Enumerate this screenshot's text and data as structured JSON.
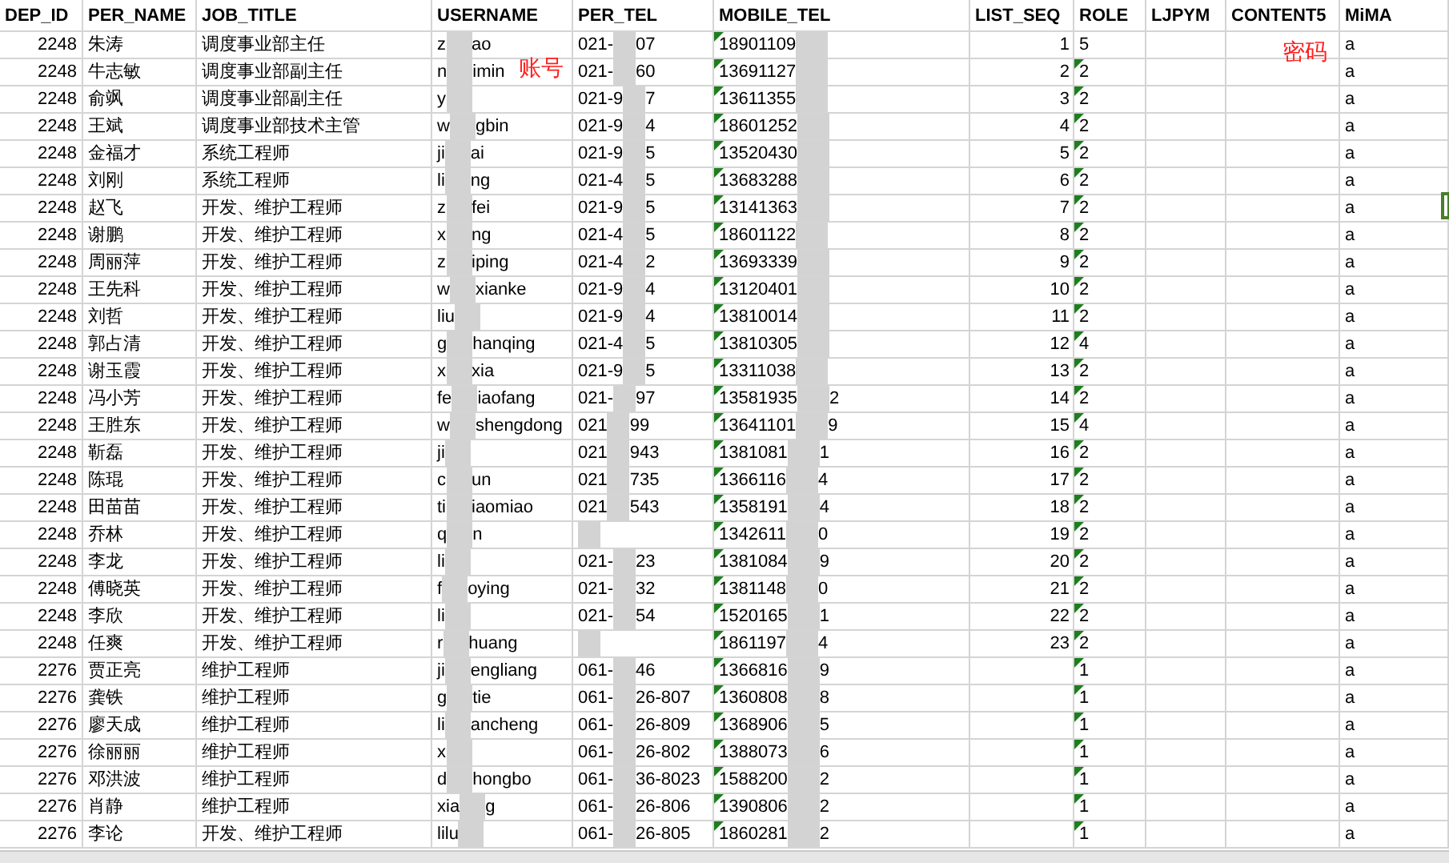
{
  "columns": [
    "DEP_ID",
    "PER_NAME",
    "JOB_TITLE",
    "USERNAME",
    "PER_TEL",
    "MOBILE_TEL",
    "LIST_SEQ",
    "ROLE",
    "LJPYM",
    "CONTENT5",
    "MiMA"
  ],
  "rows": [
    {
      "dep_id": "2248",
      "per_name": "朱涛",
      "job_title": "调度事业部主任",
      "username": [
        "z",
        "ao"
      ],
      "per_tel": [
        "021-",
        "07"
      ],
      "mobile_tel": [
        "18901109"
      ],
      "mobile_flag": true,
      "list_seq": "1",
      "role": "5",
      "role_flag": false,
      "mima": "a"
    },
    {
      "dep_id": "2248",
      "per_name": "牛志敏",
      "job_title": "调度事业部副主任",
      "username": [
        "n",
        "imin"
      ],
      "per_tel": [
        "021-",
        "60"
      ],
      "mobile_tel": [
        "13691127"
      ],
      "mobile_flag": true,
      "list_seq": "2",
      "role": "2",
      "role_flag": true,
      "mima": "a"
    },
    {
      "dep_id": "2248",
      "per_name": "俞飒",
      "job_title": "调度事业部副主任",
      "username": [
        "y"
      ],
      "per_tel": [
        "021-9",
        "7"
      ],
      "mobile_tel": [
        "13611355"
      ],
      "mobile_flag": true,
      "list_seq": "3",
      "role": "2",
      "role_flag": true,
      "mima": "a"
    },
    {
      "dep_id": "2248",
      "per_name": "王斌",
      "job_title": "调度事业部技术主管",
      "username": [
        "w",
        "gbin"
      ],
      "per_tel": [
        "021-9",
        "4"
      ],
      "mobile_tel": [
        "18601252"
      ],
      "mobile_flag": true,
      "list_seq": "4",
      "role": "2",
      "role_flag": true,
      "mima": "a"
    },
    {
      "dep_id": "2248",
      "per_name": "金福才",
      "job_title": "系统工程师",
      "username": [
        "ji",
        "ai"
      ],
      "per_tel": [
        "021-9",
        "5"
      ],
      "mobile_tel": [
        "13520430"
      ],
      "mobile_flag": true,
      "list_seq": "5",
      "role": "2",
      "role_flag": true,
      "mima": "a"
    },
    {
      "dep_id": "2248",
      "per_name": "刘刚",
      "job_title": "系统工程师",
      "username": [
        "li",
        "ng"
      ],
      "per_tel": [
        "021-4",
        "5"
      ],
      "mobile_tel": [
        "13683288"
      ],
      "mobile_flag": true,
      "list_seq": "6",
      "role": "2",
      "role_flag": true,
      "mima": "a"
    },
    {
      "dep_id": "2248",
      "per_name": "赵飞",
      "job_title": "开发、维护工程师",
      "username": [
        "z",
        "fei"
      ],
      "per_tel": [
        "021-9",
        "5"
      ],
      "mobile_tel": [
        "13141363"
      ],
      "mobile_flag": true,
      "list_seq": "7",
      "role": "2",
      "role_flag": true,
      "mima": "a"
    },
    {
      "dep_id": "2248",
      "per_name": "谢鹏",
      "job_title": "开发、维护工程师",
      "username": [
        "x",
        "ng"
      ],
      "per_tel": [
        "021-4",
        "5"
      ],
      "mobile_tel": [
        "18601122"
      ],
      "mobile_flag": true,
      "list_seq": "8",
      "role": "2",
      "role_flag": true,
      "mima": "a"
    },
    {
      "dep_id": "2248",
      "per_name": "周丽萍",
      "job_title": "开发、维护工程师",
      "username": [
        "z",
        "iping"
      ],
      "per_tel": [
        "021-4",
        "2"
      ],
      "mobile_tel": [
        "13693339"
      ],
      "mobile_flag": true,
      "list_seq": "9",
      "role": "2",
      "role_flag": true,
      "mima": "a"
    },
    {
      "dep_id": "2248",
      "per_name": "王先科",
      "job_title": "开发、维护工程师",
      "username": [
        "w",
        "xianke"
      ],
      "per_tel": [
        "021-9",
        "4"
      ],
      "mobile_tel": [
        "13120401"
      ],
      "mobile_flag": true,
      "list_seq": "10",
      "role": "2",
      "role_flag": true,
      "mima": "a"
    },
    {
      "dep_id": "2248",
      "per_name": "刘哲",
      "job_title": "开发、维护工程师",
      "username": [
        "liu"
      ],
      "per_tel": [
        "021-9",
        "4"
      ],
      "mobile_tel": [
        "13810014"
      ],
      "mobile_flag": true,
      "list_seq": "11",
      "role": "2",
      "role_flag": true,
      "mima": "a"
    },
    {
      "dep_id": "2248",
      "per_name": "郭占清",
      "job_title": "开发、维护工程师",
      "username": [
        "g",
        "hanqing"
      ],
      "per_tel": [
        "021-4",
        "5"
      ],
      "mobile_tel": [
        "13810305"
      ],
      "mobile_flag": true,
      "list_seq": "12",
      "role": "4",
      "role_flag": true,
      "mima": "a"
    },
    {
      "dep_id": "2248",
      "per_name": "谢玉霞",
      "job_title": "开发、维护工程师",
      "username": [
        "x",
        "xia"
      ],
      "per_tel": [
        "021-9",
        "5"
      ],
      "mobile_tel": [
        "13311038"
      ],
      "mobile_flag": true,
      "list_seq": "13",
      "role": "2",
      "role_flag": true,
      "mima": "a"
    },
    {
      "dep_id": "2248",
      "per_name": "冯小芳",
      "job_title": "开发、维护工程师",
      "username": [
        "fe",
        "iaofang"
      ],
      "per_tel": [
        "021-",
        "97"
      ],
      "mobile_tel": [
        "13581935",
        "2"
      ],
      "mobile_flag": true,
      "list_seq": "14",
      "role": "2",
      "role_flag": true,
      "mima": "a"
    },
    {
      "dep_id": "2248",
      "per_name": "王胜东",
      "job_title": "开发、维护工程师",
      "username": [
        "w",
        "shengdong"
      ],
      "per_tel": [
        "021",
        "99"
      ],
      "mobile_tel": [
        "13641101",
        "9"
      ],
      "mobile_flag": true,
      "list_seq": "15",
      "role": "4",
      "role_flag": true,
      "mima": "a"
    },
    {
      "dep_id": "2248",
      "per_name": "靳磊",
      "job_title": "开发、维护工程师",
      "username": [
        "ji"
      ],
      "per_tel": [
        "021",
        "943"
      ],
      "mobile_tel": [
        "1381081",
        "1"
      ],
      "mobile_flag": true,
      "list_seq": "16",
      "role": "2",
      "role_flag": true,
      "mima": "a"
    },
    {
      "dep_id": "2248",
      "per_name": "陈琨",
      "job_title": "开发、维护工程师",
      "username": [
        "c",
        "un"
      ],
      "per_tel": [
        "021",
        "735"
      ],
      "mobile_tel": [
        "1366116",
        "4"
      ],
      "mobile_flag": true,
      "list_seq": "17",
      "role": "2",
      "role_flag": true,
      "mima": "a"
    },
    {
      "dep_id": "2248",
      "per_name": "田苗苗",
      "job_title": "开发、维护工程师",
      "username": [
        "ti",
        "iaomiao"
      ],
      "per_tel": [
        "021",
        "543"
      ],
      "mobile_tel": [
        "1358191",
        "4"
      ],
      "mobile_flag": true,
      "list_seq": "18",
      "role": "2",
      "role_flag": true,
      "mima": "a"
    },
    {
      "dep_id": "2248",
      "per_name": "乔林",
      "job_title": "开发、维护工程师",
      "username": [
        "q",
        "n"
      ],
      "mobile_tel": [
        "1342611",
        "0"
      ],
      "mobile_flag": true,
      "list_seq": "19",
      "role": "2",
      "role_flag": true,
      "mima": "a"
    },
    {
      "dep_id": "2248",
      "per_name": "李龙",
      "job_title": "开发、维护工程师",
      "username": [
        "li"
      ],
      "per_tel": [
        "021-",
        "23"
      ],
      "mobile_tel": [
        "1381084",
        "9"
      ],
      "mobile_flag": true,
      "list_seq": "20",
      "role": "2",
      "role_flag": true,
      "mima": "a"
    },
    {
      "dep_id": "2248",
      "per_name": "傅晓英",
      "job_title": "开发、维护工程师",
      "username": [
        "f",
        "oying"
      ],
      "per_tel": [
        "021-",
        "32"
      ],
      "mobile_tel": [
        "1381148",
        "0"
      ],
      "mobile_flag": true,
      "list_seq": "21",
      "role": "2",
      "role_flag": true,
      "mima": "a"
    },
    {
      "dep_id": "2248",
      "per_name": "李欣",
      "job_title": "开发、维护工程师",
      "username": [
        "li"
      ],
      "per_tel": [
        "021-",
        "54"
      ],
      "mobile_tel": [
        "1520165",
        "1"
      ],
      "mobile_flag": true,
      "list_seq": "22",
      "role": "2",
      "role_flag": true,
      "mima": "a"
    },
    {
      "dep_id": "2248",
      "per_name": "任爽",
      "job_title": "开发、维护工程师",
      "username": [
        "r",
        "huang"
      ],
      "mobile_tel": [
        "1861197",
        "4"
      ],
      "mobile_flag": true,
      "list_seq": "23",
      "role": "2",
      "role_flag": true,
      "mima": "a"
    },
    {
      "dep_id": "2276",
      "per_name": "贾正亮",
      "job_title": "维护工程师",
      "username": [
        "ji",
        "engliang"
      ],
      "per_tel": [
        "061-",
        "46"
      ],
      "mobile_tel": [
        "1366816",
        "9"
      ],
      "mobile_flag": true,
      "role": "1",
      "role_flag": true,
      "mima": "a"
    },
    {
      "dep_id": "2276",
      "per_name": "龚铁",
      "job_title": "维护工程师",
      "username": [
        "g",
        "tie"
      ],
      "per_tel": [
        "061-",
        "26-807"
      ],
      "mobile_tel": [
        "1360808",
        "8"
      ],
      "mobile_flag": true,
      "role": "1",
      "role_flag": true,
      "mima": "a"
    },
    {
      "dep_id": "2276",
      "per_name": "廖天成",
      "job_title": "维护工程师",
      "username": [
        "li",
        "ancheng"
      ],
      "per_tel": [
        "061-",
        "26-809"
      ],
      "mobile_tel": [
        "1368906",
        "5"
      ],
      "mobile_flag": true,
      "role": "1",
      "role_flag": true,
      "mima": "a"
    },
    {
      "dep_id": "2276",
      "per_name": "徐丽丽",
      "job_title": "维护工程师",
      "username": [
        "x"
      ],
      "per_tel": [
        "061-",
        "26-802"
      ],
      "mobile_tel": [
        "1388073",
        "6"
      ],
      "mobile_flag": true,
      "role": "1",
      "role_flag": true,
      "mima": "a"
    },
    {
      "dep_id": "2276",
      "per_name": "邓洪波",
      "job_title": "维护工程师",
      "username": [
        "d",
        "hongbo"
      ],
      "per_tel": [
        "061-",
        "36-8023"
      ],
      "mobile_tel": [
        "1588200",
        "2"
      ],
      "mobile_flag": true,
      "role": "1",
      "role_flag": true,
      "mima": "a"
    },
    {
      "dep_id": "2276",
      "per_name": "肖静",
      "job_title": "维护工程师",
      "username": [
        "xia",
        "g"
      ],
      "per_tel": [
        "061-",
        "26-806"
      ],
      "mobile_tel": [
        "1390806",
        "2"
      ],
      "mobile_flag": true,
      "role": "1",
      "role_flag": true,
      "mima": "a"
    },
    {
      "dep_id": "2276",
      "per_name": "李论",
      "job_title": "开发、维护工程师",
      "username": [
        "lilu"
      ],
      "per_tel": [
        "061-",
        "26-805"
      ],
      "mobile_tel": [
        "1860281",
        "2"
      ],
      "mobile_flag": true,
      "role": "1",
      "role_flag": true,
      "mima": "a"
    }
  ],
  "annotations": [
    {
      "kind": "account",
      "text": "账号"
    },
    {
      "kind": "password",
      "text": "密码"
    }
  ]
}
